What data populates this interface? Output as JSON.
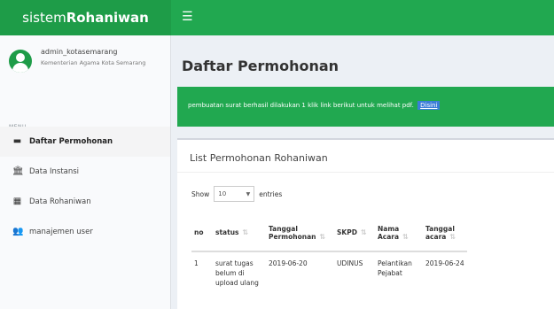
{
  "header": {
    "logo_light": "sistem",
    "logo_bold": "Rohaniwan",
    "menu_toggle_icon": "hamburger-icon"
  },
  "sidebar": {
    "user_name": "admin_kotasemarang",
    "user_org": "Kementerian Agama Kota Semarang",
    "menu_header": "MENU",
    "items": [
      {
        "label": "Daftar Permohonan",
        "icon": "inbox-icon",
        "active": true
      },
      {
        "label": "Data Instansi",
        "icon": "bank-icon",
        "active": false
      },
      {
        "label": "Data Rohaniwan",
        "icon": "table-icon",
        "active": false
      },
      {
        "label": "manajemen user",
        "icon": "users-icon",
        "active": false
      }
    ]
  },
  "main": {
    "page_title": "Daftar Permohonan",
    "alert_text": "pembuatan surat berhasil dilakukan 1 klik link berikut untuk melihat pdf.",
    "alert_link": "Disini",
    "box_title": "List Permohonan Rohaniwan",
    "length": {
      "prefix": "Show",
      "value": "10",
      "suffix": "entries"
    },
    "table": {
      "headers": [
        "no",
        "status",
        "Tanggal Permohonan",
        "SKPD",
        "Nama Acara",
        "Tanggal acara"
      ],
      "rows": [
        [
          "1",
          "surat tugas belum di upload ulang",
          "2019-06-20",
          "UDINUS",
          "Pelantikan Pejabat",
          "2019-06-24"
        ]
      ]
    }
  },
  "colors": {
    "brand_green": "#21a850",
    "brand_green_dark": "#1e9c48",
    "link_blue": "#3b7dd8"
  }
}
